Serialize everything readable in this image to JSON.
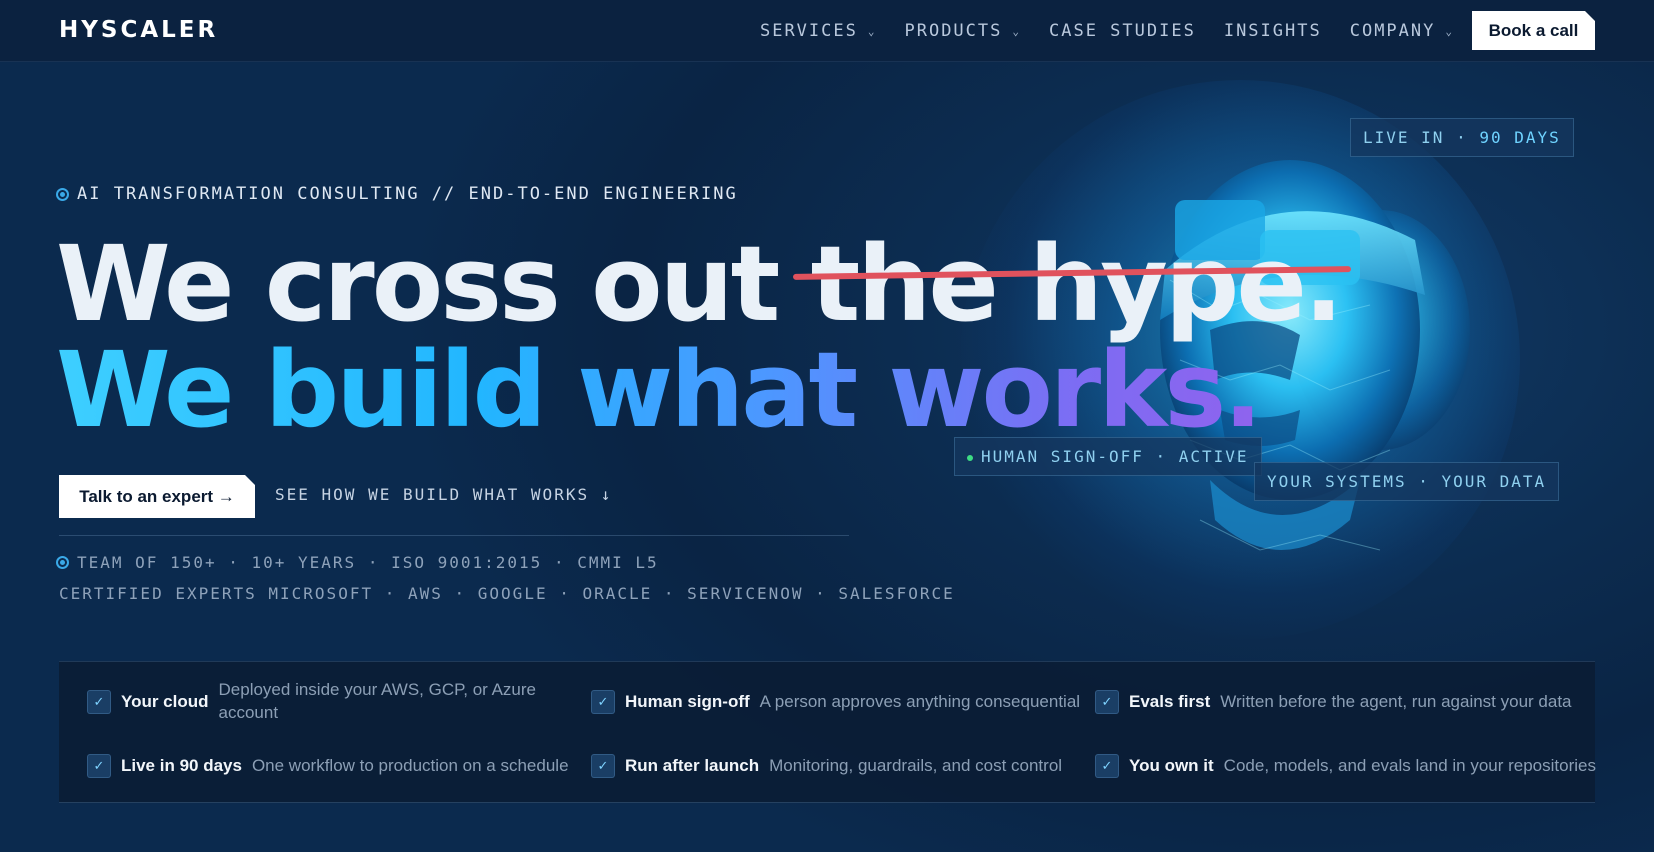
{
  "nav": {
    "logo": "HYSCALER",
    "items": [
      {
        "label": "SERVICES",
        "has_dropdown": true
      },
      {
        "label": "PRODUCTS",
        "has_dropdown": true
      },
      {
        "label": "CASE STUDIES",
        "has_dropdown": false
      },
      {
        "label": "INSIGHTS",
        "has_dropdown": false
      },
      {
        "label": "COMPANY",
        "has_dropdown": true
      }
    ],
    "cta_label": "Book a call"
  },
  "hero": {
    "eyebrow": "AI TRANSFORMATION CONSULTING // END-TO-END ENGINEERING",
    "headline_line1_plain": "We cross out ",
    "headline_line1_struck": "the hype.",
    "headline_line2": "We build what works.",
    "primary_cta": "Talk to an expert →",
    "secondary_cta": "SEE HOW WE BUILD WHAT WORKS ↓",
    "credentials_line1": "TEAM OF 150+ · 10+ YEARS · ISO 9001:2015 · CMMI L5",
    "credentials_line2": "CERTIFIED EXPERTS MICROSOFT · AWS · GOOGLE · ORACLE · SERVICENOW · SALESFORCE"
  },
  "tags": {
    "live_prefix": "LIVE IN · ",
    "live_value": "90 DAYS",
    "signoff": "HUMAN SIGN-OFF · ACTIVE",
    "systems": "YOUR SYSTEMS · YOUR DATA"
  },
  "features": [
    {
      "title": "Your cloud",
      "desc": "Deployed inside your AWS, GCP, or Azure account"
    },
    {
      "title": "Human sign-off",
      "desc": "A person approves anything consequential"
    },
    {
      "title": "Evals first",
      "desc": "Written before the agent, run against your data"
    },
    {
      "title": "Live in 90 days",
      "desc": "One workflow to production on a schedule"
    },
    {
      "title": "Run after launch",
      "desc": "Monitoring, guardrails, and cost control"
    },
    {
      "title": "You own it",
      "desc": "Code, models, and evals land in your repositories"
    }
  ],
  "colors": {
    "strike": "#e0525d",
    "accent_cyan": "#3ecfff",
    "accent_violet": "#8f63ee",
    "background": "#0b2a4e"
  }
}
